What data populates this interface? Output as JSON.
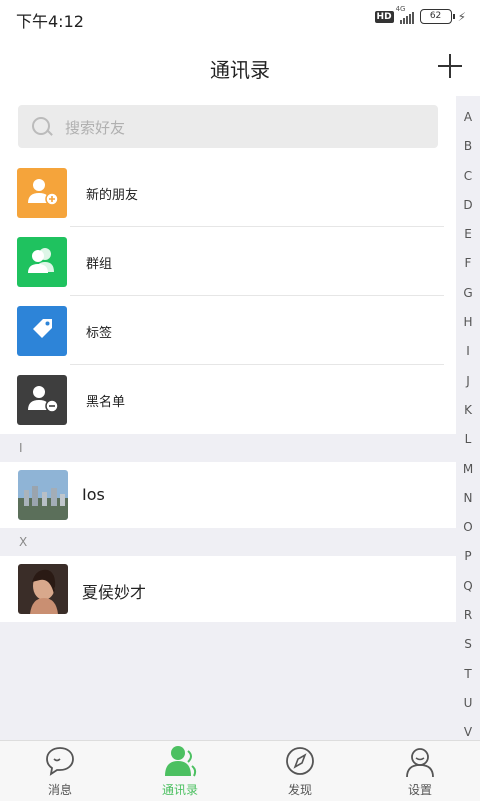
{
  "status": {
    "time": "下午4:12",
    "hd": "HD",
    "net": "4G",
    "battery": "62"
  },
  "header": {
    "title": "通讯录"
  },
  "search": {
    "placeholder": "搜索好友"
  },
  "menu": [
    {
      "label": "新的朋友",
      "color": "#f5a43b",
      "icon": "person-add-icon"
    },
    {
      "label": "群组",
      "color": "#1fc25f",
      "icon": "group-icon"
    },
    {
      "label": "标签",
      "color": "#2d84d8",
      "icon": "tag-icon"
    },
    {
      "label": "黑名单",
      "color": "#3e3e3e",
      "icon": "person-block-icon"
    }
  ],
  "sections": [
    {
      "letter": "I",
      "contact": "Ios"
    },
    {
      "letter": "X",
      "contact": "夏侯妙才"
    }
  ],
  "index": [
    "A",
    "B",
    "C",
    "D",
    "E",
    "F",
    "G",
    "H",
    "I",
    "J",
    "K",
    "L",
    "M",
    "N",
    "O",
    "P",
    "Q",
    "R",
    "S",
    "T",
    "U",
    "V"
  ],
  "tabs": [
    {
      "label": "消息",
      "icon": "chat-bubble-icon"
    },
    {
      "label": "通讯录",
      "icon": "contacts-icon",
      "active": true
    },
    {
      "label": "发现",
      "icon": "compass-icon"
    },
    {
      "label": "设置",
      "icon": "user-settings-icon"
    }
  ],
  "colors": {
    "accent": "#4cc061"
  }
}
